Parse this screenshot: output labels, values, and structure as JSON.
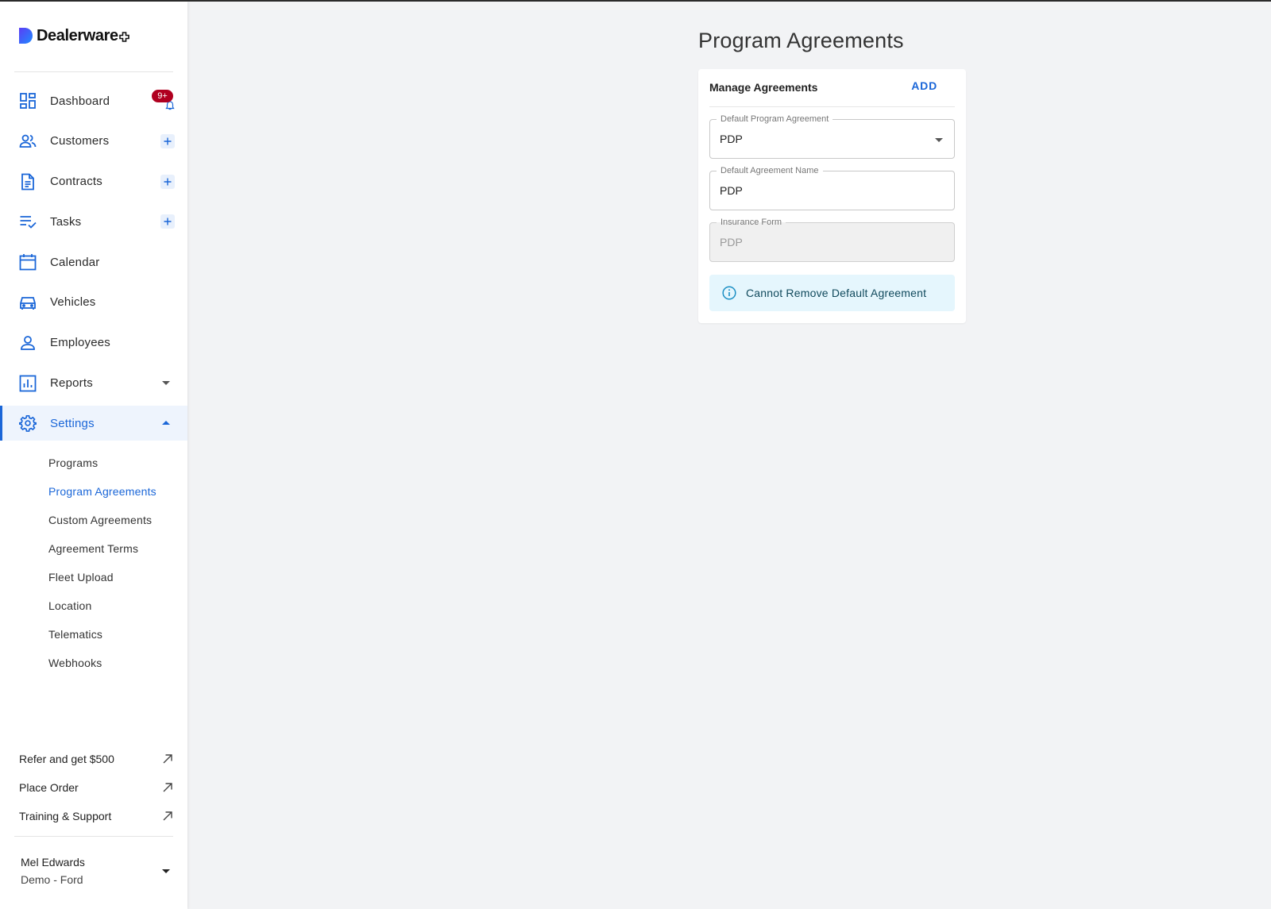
{
  "brand": {
    "name": "Dealerware",
    "accent": "#1a66d8"
  },
  "sidebar": {
    "nav": [
      {
        "label": "Dashboard",
        "icon": "dashboard-icon",
        "badge": "9+"
      },
      {
        "label": "Customers",
        "icon": "customers-icon",
        "add": true
      },
      {
        "label": "Contracts",
        "icon": "contracts-icon",
        "add": true
      },
      {
        "label": "Tasks",
        "icon": "tasks-icon",
        "add": true
      },
      {
        "label": "Calendar",
        "icon": "calendar-icon"
      },
      {
        "label": "Vehicles",
        "icon": "vehicle-icon"
      },
      {
        "label": "Employees",
        "icon": "employee-icon"
      },
      {
        "label": "Reports",
        "icon": "reports-icon",
        "expand": "collapsed"
      },
      {
        "label": "Settings",
        "icon": "gear-icon",
        "expand": "expanded",
        "active": true
      }
    ],
    "settings_sub": [
      {
        "label": "Programs"
      },
      {
        "label": "Program Agreements",
        "active": true
      },
      {
        "label": "Custom Agreements"
      },
      {
        "label": "Agreement Terms"
      },
      {
        "label": "Fleet Upload"
      },
      {
        "label": "Location"
      },
      {
        "label": "Telematics"
      },
      {
        "label": "Webhooks"
      }
    ],
    "external_links": [
      {
        "label": "Refer and get $500"
      },
      {
        "label": "Place Order"
      },
      {
        "label": "Training & Support"
      }
    ],
    "user": {
      "name": "Mel Edwards",
      "org": "Demo - Ford"
    }
  },
  "main": {
    "title": "Program Agreements",
    "card": {
      "title": "Manage Agreements",
      "add_label": "ADD",
      "fields": [
        {
          "label": "Default Program Agreement",
          "value": "PDP",
          "type": "select"
        },
        {
          "label": "Default Agreement Name",
          "value": "PDP",
          "type": "text"
        },
        {
          "label": "Insurance Form",
          "value": "PDP",
          "type": "disabled"
        }
      ],
      "alert": "Cannot Remove Default Agreement"
    }
  }
}
